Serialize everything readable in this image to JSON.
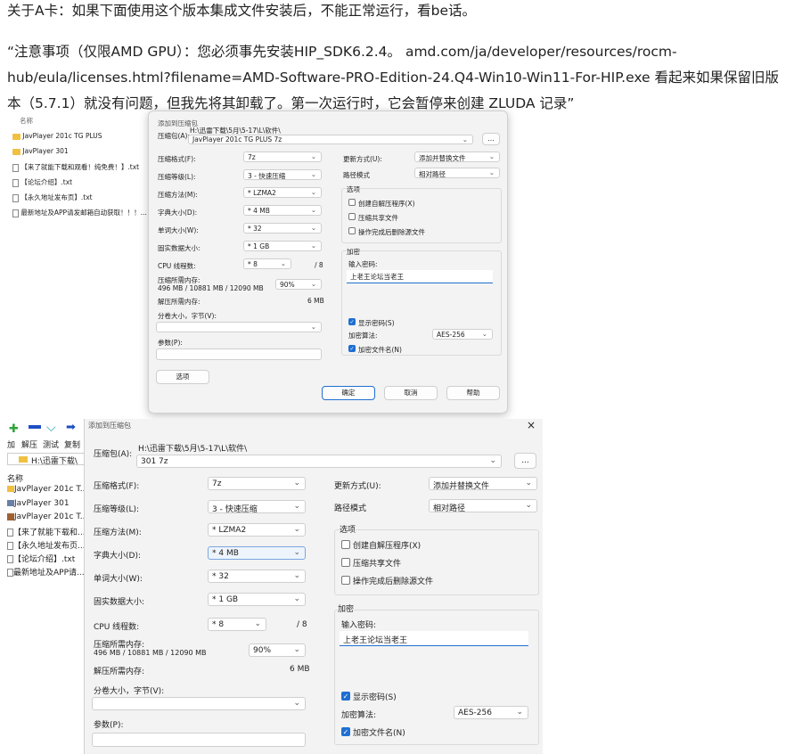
{
  "paragraphs": {
    "p1": "关于A卡：如果下面使用这个版本集成文件安装后，不能正常运行，看be话。",
    "p2_line1": "“注意事项（仅限AMD GPU）：您必须事先安装HIP_SDK6.2.4。 amd.com/ja/developer/resources/rocm-",
    "p2_line2": "hub/eula/licenses.html?filename=AMD-Software-PRO-Edition-24.Q4-Win10-Win11-For-HIP.exe 看起来如果保留旧版",
    "p2_line3": "本（5.7.1）就没有问题，但我先将其卸载了。第一次运行时，它会暂停来创建 ZLUDA 记录”"
  },
  "shot1": {
    "file_header": "名称",
    "files": [
      {
        "name": "JavPlayer 201c TG PLUS",
        "icon": "folder-icon"
      },
      {
        "name": "JavPlayer 301",
        "icon": "folder-icon"
      },
      {
        "name": "【来了就能下载和观看！纯免费！】.txt",
        "icon": "text-file-icon"
      },
      {
        "name": "【论坛介绍】.txt",
        "icon": "text-file-icon"
      },
      {
        "name": "【永久地址发布页】.txt",
        "icon": "text-file-icon"
      },
      {
        "name": "最新地址及APP请发邮箱自动获取！！！...",
        "icon": "text-file-icon"
      }
    ],
    "dialog": {
      "title": "添加到压缩包",
      "archive_label": "压缩包(A):",
      "archive_path": "H:\\迅雷下载\\5月\\5-17\\L\\软件\\",
      "archive_name": "JavPlayer 201c TG PLUS 7z",
      "browse": "...",
      "format_label": "压缩格式(F):",
      "format": "7z",
      "level_label": "压缩等级(L):",
      "level": "3 - 快速压缩",
      "method_label": "压缩方法(M):",
      "method": "* LZMA2",
      "dict_label": "字典大小(D):",
      "dict": "* 4 MB",
      "word_label": "单词大小(W):",
      "word": "* 32",
      "solid_label": "固实数据大小:",
      "solid": "* 1 GB",
      "cpu_label": "CPU 线程数:",
      "cpu": "* 8",
      "cpu_max": "/ 8",
      "mem_label": "压缩所需内存:",
      "mem_values": "496 MB / 10881 MB / 12090 MB",
      "mem_pct": "90%",
      "dmem_label": "解压所需内存:",
      "dmem": "6 MB",
      "split_label": "分卷大小，字节(V):",
      "params_label": "参数(P):",
      "options_btn": "选项",
      "update_label": "更新方式(U):",
      "update": "添加并替换文件",
      "path_label": "路径模式",
      "path_mode": "相对路径",
      "options_group": "选项",
      "sfx": "创建自解压程序(X)",
      "shared": "压缩共享文件",
      "delete_after": "操作完成后删除源文件",
      "enc_group": "加密",
      "pwd_label": "输入密码:",
      "pwd": "上老王论坛当老王",
      "show_pwd": "显示密码(S)",
      "enc_method_label": "加密算法:",
      "enc_method": "AES-256",
      "enc_names": "加密文件名(N)",
      "ok": "确定",
      "cancel": "取消",
      "help": "帮助"
    }
  },
  "shot2": {
    "toolbar": [
      "加",
      "解压",
      "测试",
      "复制"
    ],
    "toolbar_colors": {
      "add": "#2fa33a",
      "extract": "#1d4fc4",
      "test": "#1d9fb4",
      "copy": "#1d4fc4"
    },
    "address": "H:\\迅雷下载\\",
    "file_header": "名称",
    "files": [
      {
        "name": "JavPlayer 201c T...",
        "icon": "folder-icon"
      },
      {
        "name": "JavPlayer 301",
        "icon": "archive-icon"
      },
      {
        "name": "JavPlayer 201c T...",
        "icon": "archive-icon"
      },
      {
        "name": "【来了就能下载和...",
        "icon": "text-file-icon"
      },
      {
        "name": "【永久地址发布页...",
        "icon": "text-file-icon"
      },
      {
        "name": "【论坛介绍】.txt",
        "icon": "text-file-icon"
      },
      {
        "name": "最新地址及APP请...",
        "icon": "text-file-icon"
      }
    ],
    "dialog": {
      "title": "添加到压缩包",
      "close": "×",
      "archive_label": "压缩包(A):",
      "archive_path": "H:\\迅雷下载\\5月\\5-17\\L\\软件\\",
      "archive_name": "301 7z",
      "browse": "...",
      "format_label": "压缩格式(F):",
      "format": "7z",
      "level_label": "压缩等级(L):",
      "level": "3 - 快速压缩",
      "method_label": "压缩方法(M):",
      "method": "* LZMA2",
      "dict_label": "字典大小(D):",
      "dict": "* 4 MB",
      "word_label": "单词大小(W):",
      "word": "* 32",
      "solid_label": "固实数据大小:",
      "solid": "* 1 GB",
      "cpu_label": "CPU 线程数:",
      "cpu": "* 8",
      "cpu_max": "/ 8",
      "mem_label": "压缩所需内存:",
      "mem_values": "496 MB / 10881 MB / 12090 MB",
      "mem_pct": "90%",
      "dmem_label": "解压所需内存:",
      "dmem": "6 MB",
      "split_label": "分卷大小，字节(V):",
      "params_label": "参数(P):",
      "update_label": "更新方式(U):",
      "update": "添加并替换文件",
      "path_label": "路径模式",
      "path_mode": "相对路径",
      "options_group": "选项",
      "sfx": "创建自解压程序(X)",
      "shared": "压缩共享文件",
      "delete_after": "操作完成后删除源文件",
      "enc_group": "加密",
      "pwd_label": "输入密码:",
      "pwd": "上老王论坛当老王",
      "show_pwd": "显示密码(S)",
      "enc_method_label": "加密算法:",
      "enc_method": "AES-256",
      "enc_names": "加密文件名(N)"
    }
  },
  "colors": {
    "accent": "#1f6fd1",
    "folder": "#f0c040"
  }
}
